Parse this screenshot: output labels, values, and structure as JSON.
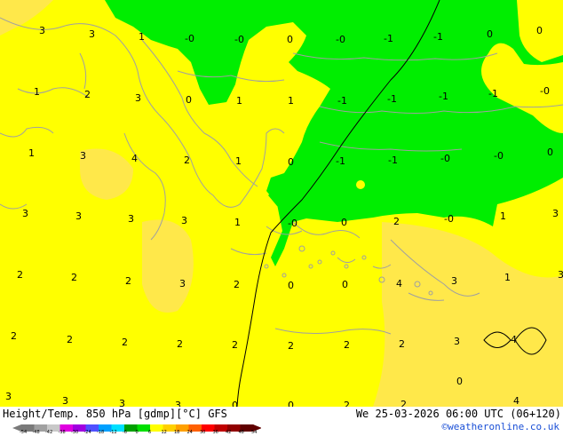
{
  "map": {
    "labels": [
      "3",
      "3",
      "1",
      "-0",
      "-0",
      "0",
      "-0",
      "-1",
      "-1",
      "0",
      "0",
      "1",
      "2",
      "3",
      "0",
      "1",
      "1",
      "-1",
      "-1",
      "-1",
      "-1",
      "-0",
      "1",
      "3",
      "4",
      "2",
      "1",
      "0",
      "-1",
      "-1",
      "-0",
      "-0",
      "0",
      "3",
      "3",
      "3",
      "3",
      "1",
      "-0",
      "0",
      "2",
      "-0",
      "1",
      "3",
      "2",
      "2",
      "2",
      "3",
      "2",
      "0",
      "0",
      "4",
      "3",
      "1",
      "3",
      "2",
      "2",
      "2",
      "2",
      "2",
      "2",
      "2",
      "2",
      "3",
      "4",
      "3",
      "3",
      "3",
      "3",
      "0",
      "0",
      "2",
      "2",
      "4",
      "0"
    ],
    "colors": {
      "land_yellow": "#ffff00",
      "warm_yellow": "#ffe000",
      "green": "#00ee00",
      "border": "#a0a0a0",
      "track": "#000000"
    }
  },
  "footer": {
    "title": "Height/Temp. 850 hPa [gdmp][°C] GFS",
    "datetime": "We 25-03-2026 06:00 UTC (06+120)",
    "credit": "©weatheronline.co.uk"
  },
  "colorbar": {
    "ticks": [
      "-54",
      "-48",
      "-42",
      "-38",
      "-30",
      "-24",
      "-18",
      "-12",
      "-6",
      "0",
      "6",
      "12",
      "18",
      "24",
      "30",
      "36",
      "42",
      "48",
      "54"
    ],
    "colors": [
      "#7a7a7a",
      "#a0a0a0",
      "#c8c8c8",
      "#e000e0",
      "#a000e0",
      "#5050ff",
      "#00a0ff",
      "#00e0ff",
      "#00a000",
      "#00e000",
      "#ffff00",
      "#ffd000",
      "#ffa000",
      "#ff6000",
      "#ff0000",
      "#c00000",
      "#900000",
      "#600000"
    ]
  }
}
